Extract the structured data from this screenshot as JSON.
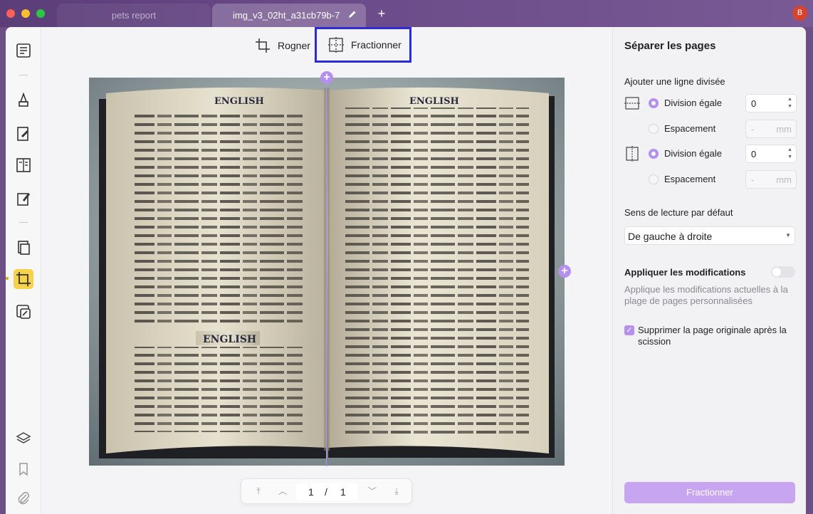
{
  "tabs": [
    {
      "label": "pets report"
    },
    {
      "label": "img_v3_02ht_a31cb79b-7"
    }
  ],
  "avatar_letter": "B",
  "toolbar": {
    "crop_label": "Rogner",
    "split_label": "Fractionner"
  },
  "document": {
    "header_left": "ENGLISH",
    "header_right": "ENGLISH",
    "mid_heading": "ENGLISH"
  },
  "pager": {
    "current": "1",
    "separator": "/",
    "total": "1"
  },
  "panel": {
    "title": "Séparer les pages",
    "add_line_label": "Ajouter une ligne divisée",
    "horizontal": {
      "equal_label": "Division égale",
      "equal_value": "0",
      "spacing_label": "Espacement",
      "spacing_value": "-",
      "spacing_unit": "mm"
    },
    "vertical": {
      "equal_label": "Division égale",
      "equal_value": "0",
      "spacing_label": "Espacement",
      "spacing_value": "-",
      "spacing_unit": "mm"
    },
    "reading_label": "Sens de lecture par défaut",
    "reading_value": "De gauche à droite",
    "apply_label": "Appliquer les modifications",
    "apply_desc": "Applique les modifications actuelles à la plage de pages personnalisées",
    "delete_label": "Supprimer la page originale après la scission",
    "split_button": "Fractionner"
  },
  "colors": {
    "accent": "#b690ee",
    "highlight_border": "#2b2bdc",
    "active_tool": "#f6d14b"
  }
}
